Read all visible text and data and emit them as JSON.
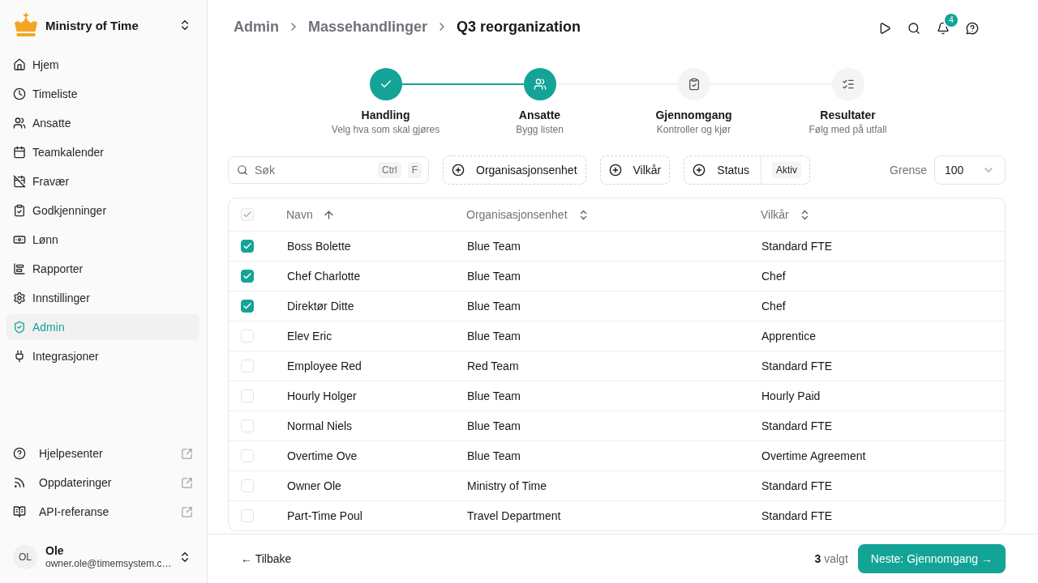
{
  "sidebar": {
    "workspace": {
      "name": "Ministry of Time"
    },
    "nav": [
      {
        "label": "Hjem",
        "selected": false
      },
      {
        "label": "Timeliste",
        "selected": false
      },
      {
        "label": "Ansatte",
        "selected": false
      },
      {
        "label": "Teamkalender",
        "selected": false
      },
      {
        "label": "Fravær",
        "selected": false
      },
      {
        "label": "Godkjenninger",
        "selected": false
      },
      {
        "label": "Lønn",
        "selected": false
      },
      {
        "label": "Rapporter",
        "selected": false
      },
      {
        "label": "Innstillinger",
        "selected": false
      },
      {
        "label": "Admin",
        "selected": true
      },
      {
        "label": "Integrasjoner",
        "selected": false
      }
    ],
    "links": [
      {
        "label": "Hjelpesenter"
      },
      {
        "label": "Oppdateringer"
      },
      {
        "label": "API-referanse"
      }
    ],
    "user": {
      "initials": "OL",
      "name": "Ole",
      "email": "owner.ole@timemsystem.c…"
    }
  },
  "header": {
    "breadcrumb": [
      {
        "label": "Admin"
      },
      {
        "label": "Massehandlinger"
      },
      {
        "label": "Q3 reorganization"
      }
    ],
    "notification_count": "4"
  },
  "stepper": {
    "steps": [
      {
        "kind": "done",
        "title": "Handling",
        "subtitle": "Velg hva som skal gjøres"
      },
      {
        "kind": "current",
        "title": "Ansatte",
        "subtitle": "Bygg listen"
      },
      {
        "kind": "upcoming",
        "title": "Gjennomgang",
        "subtitle": "Kontroller og kjør"
      },
      {
        "kind": "upcoming",
        "title": "Resultater",
        "subtitle": "Følg med på utfall"
      }
    ]
  },
  "filters": {
    "search": {
      "placeholder": "Søk",
      "shortcut": [
        "Ctrl",
        "F"
      ]
    },
    "buttons": [
      {
        "label": "Organisasjonsenhet"
      },
      {
        "label": "Vilkår"
      },
      {
        "label": "Status",
        "value": "Aktiv"
      }
    ],
    "limit": {
      "label": "Grense",
      "value": "100"
    }
  },
  "table": {
    "select_all": {
      "indeterminate": true
    },
    "columns": [
      {
        "label": "Navn",
        "sorted": true
      },
      {
        "label": "Organisasjonsenhet",
        "sorted": false
      },
      {
        "label": "Vilkår",
        "sorted": false
      }
    ],
    "rows": [
      {
        "name": "Boss Bolette",
        "unit": "Blue Team",
        "terms": "Standard FTE",
        "checked": true
      },
      {
        "name": "Chef Charlotte",
        "unit": "Blue Team",
        "terms": "Chef",
        "checked": true
      },
      {
        "name": "Direktør Ditte",
        "unit": "Blue Team",
        "terms": "Chef",
        "checked": true
      },
      {
        "name": "Elev Eric",
        "unit": "Blue Team",
        "terms": "Apprentice",
        "checked": false
      },
      {
        "name": "Employee Red",
        "unit": "Red Team",
        "terms": "Standard FTE",
        "checked": false
      },
      {
        "name": "Hourly Holger",
        "unit": "Blue Team",
        "terms": "Hourly Paid",
        "checked": false
      },
      {
        "name": "Normal Niels",
        "unit": "Blue Team",
        "terms": "Standard FTE",
        "checked": false
      },
      {
        "name": "Overtime Ove",
        "unit": "Blue Team",
        "terms": "Overtime Agreement",
        "checked": false
      },
      {
        "name": "Owner Ole",
        "unit": "Ministry of Time",
        "terms": "Standard FTE",
        "checked": false
      },
      {
        "name": "Part-Time Poul",
        "unit": "Travel Department",
        "terms": "Standard FTE",
        "checked": false
      }
    ]
  },
  "footer": {
    "back": "← Tilbake",
    "selection": "**3** valgt",
    "next": "Neste: Gjennomgang →"
  }
}
